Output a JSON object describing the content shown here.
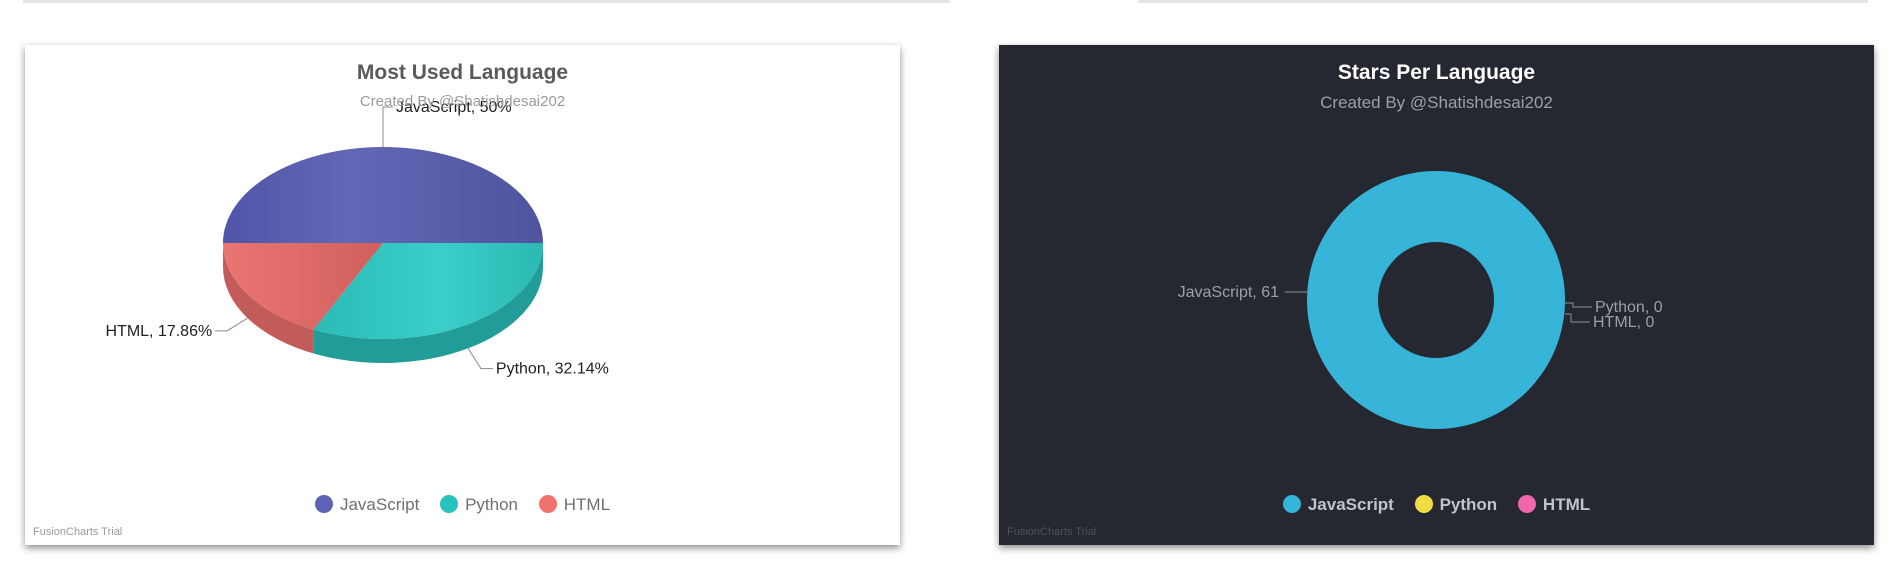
{
  "chart_data": [
    {
      "type": "pie",
      "title": "Most Used Language",
      "subtitle": "Created By @Shatishdesai202",
      "categories": [
        "JavaScript",
        "Python",
        "HTML"
      ],
      "values": [
        50,
        32.14,
        17.86
      ],
      "value_labels": [
        "JavaScript, 50%",
        "Python, 32.14%",
        "HTML, 17.86%"
      ],
      "colors": [
        "#5d62b5",
        "#29c3be",
        "#f2726f"
      ],
      "legend_position": "bottom",
      "theme": "light",
      "style": "3d"
    },
    {
      "type": "pie",
      "title": "Stars Per Language",
      "subtitle": "Created By @Shatishdesai202",
      "categories": [
        "JavaScript",
        "Python",
        "HTML"
      ],
      "values": [
        61,
        0,
        0
      ],
      "value_labels": [
        "JavaScript, 61",
        "Python, 0",
        "HTML, 0"
      ],
      "colors": [
        "#36b5d8",
        "#f0dc46",
        "#f066ac"
      ],
      "legend_position": "bottom",
      "theme": "dark",
      "style": "doughnut"
    }
  ],
  "watermark": "FusionCharts Trial"
}
